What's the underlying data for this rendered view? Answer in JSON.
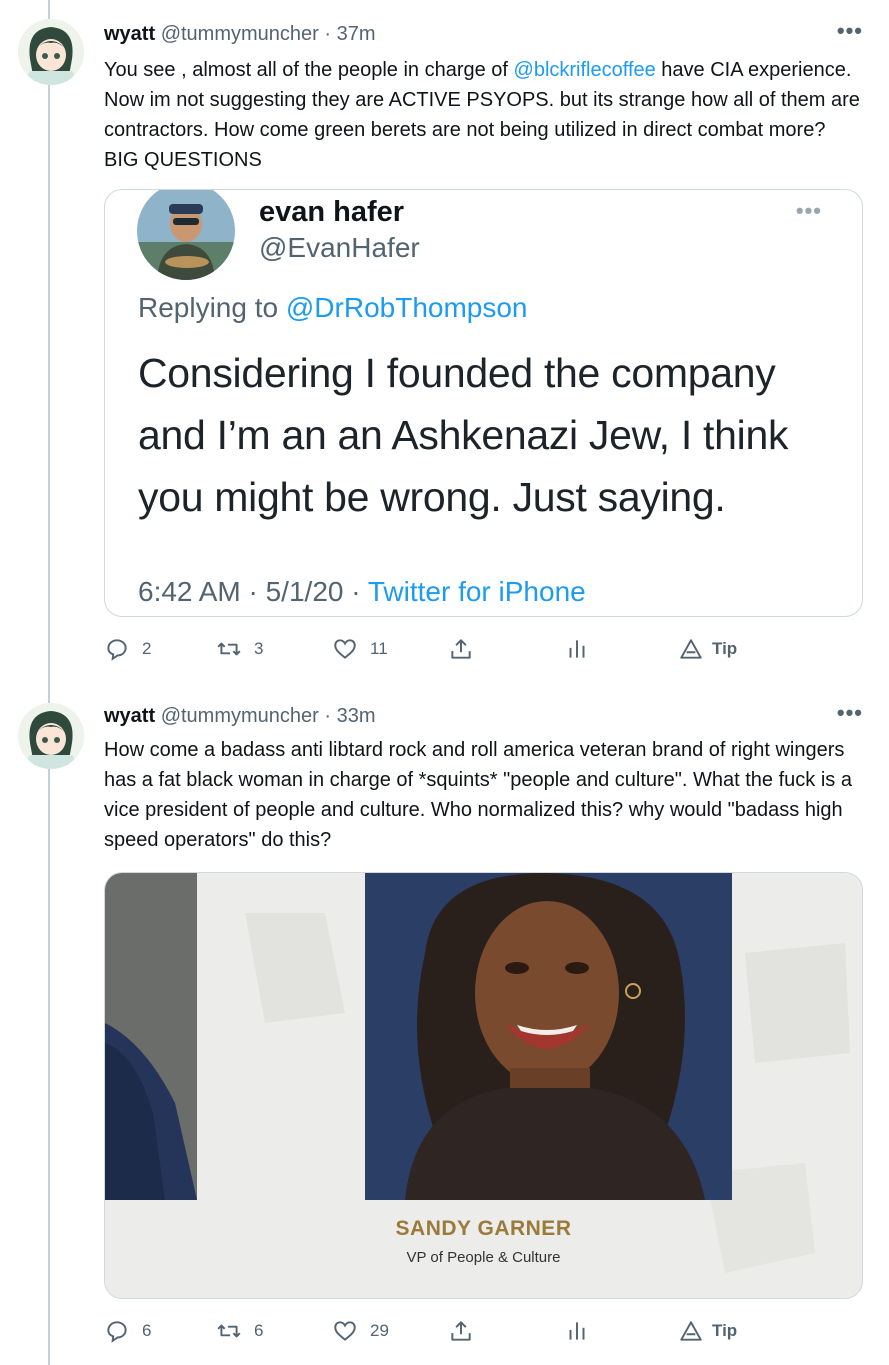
{
  "tweets": [
    {
      "author_name": "wyatt",
      "handle": "@tummymuncher",
      "time": "· 37m",
      "more": "•••",
      "text_1": "You see , almost all of the people in charge of ",
      "mention": "@blckriflecoffee",
      "text_2": " have CIA experience. Now im not suggesting they are ACTIVE PSYOPS. but its strange how all of them are contractors. How come green berets are not being utilized in direct combat more? BIG QUESTIONS",
      "quote": {
        "name": "evan hafer",
        "handle": "@EvanHafer",
        "more": "•••",
        "replying_prefix": "Replying to ",
        "replying_to": "@DrRobThompson",
        "text": "Considering I founded the company and I’m an an Ashkenazi Jew, I think you might be wrong. Just saying.",
        "time": "6:42 AM · 5/1/20 · ",
        "source": "Twitter for iPhone"
      },
      "actions": {
        "replies": "2",
        "retweets": "3",
        "likes": "11",
        "tip": "Tip"
      }
    },
    {
      "author_name": "wyatt",
      "handle": "@tummymuncher",
      "time": "· 33m",
      "more": "•••",
      "text": "How come a badass anti libtard rock and roll america veteran brand of right wingers has a fat black woman in charge of *squints* \"people and culture\". What the fuck is a vice president of people and culture. Who normalized this? why would \"badass high speed operators\" do this?",
      "media": {
        "caption_name": "SANDY GARNER",
        "caption_title": "VP of People & Culture"
      },
      "actions": {
        "replies": "6",
        "retweets": "6",
        "likes": "29",
        "tip": "Tip"
      }
    }
  ],
  "colors": {
    "accent": "#1d9bf0",
    "muted": "#536471",
    "border": "#cfd9de",
    "caption_gold": "#9b7a3a"
  },
  "icons": [
    "reply-icon",
    "retweet-icon",
    "like-icon",
    "share-icon",
    "analytics-icon",
    "tip-icon"
  ]
}
